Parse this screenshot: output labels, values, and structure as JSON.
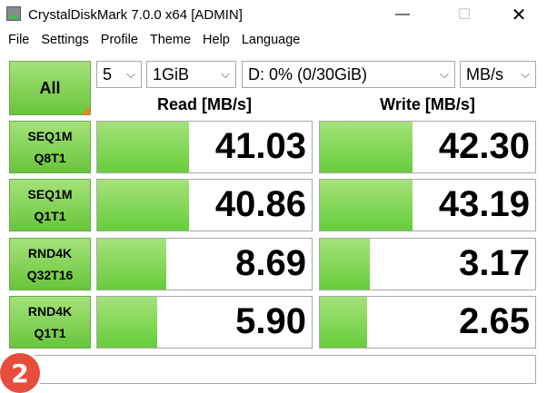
{
  "window": {
    "title": "CrystalDiskMark 7.0.0 x64 [ADMIN]",
    "min_icon": "minimize-icon",
    "max_icon": "maximize-icon",
    "close_icon": "close-icon",
    "min_glyph": "—",
    "max_glyph": "☐",
    "close_glyph": "✕"
  },
  "menu": [
    "File",
    "Settings",
    "Profile",
    "Theme",
    "Help",
    "Language"
  ],
  "controls": {
    "all_label": "All",
    "count": "5",
    "size": "1GiB",
    "drive": "D: 0% (0/30GiB)",
    "unit": "MB/s",
    "chevron": "⌵"
  },
  "headers": {
    "read": "Read [MB/s]",
    "write": "Write [MB/s]"
  },
  "tests": [
    {
      "line1": "SEQ1M",
      "line2": "Q8T1",
      "read": "41.03",
      "write": "42.30",
      "read_fill": 0.43,
      "write_fill": 0.43
    },
    {
      "line1": "SEQ1M",
      "line2": "Q1T1",
      "read": "40.86",
      "write": "43.19",
      "read_fill": 0.43,
      "write_fill": 0.43
    },
    {
      "line1": "RND4K",
      "line2": "Q32T16",
      "read": "8.69",
      "write": "3.17",
      "read_fill": 0.32,
      "write_fill": 0.23
    },
    {
      "line1": "RND4K",
      "line2": "Q1T1",
      "read": "5.90",
      "write": "2.65",
      "read_fill": 0.28,
      "write_fill": 0.22
    }
  ],
  "status_text": "",
  "badge": {
    "text": "2",
    "color": "#e74c3c"
  },
  "colors": {
    "accent_green": "#66cd3a",
    "corner_orange": "#f07f1b"
  }
}
